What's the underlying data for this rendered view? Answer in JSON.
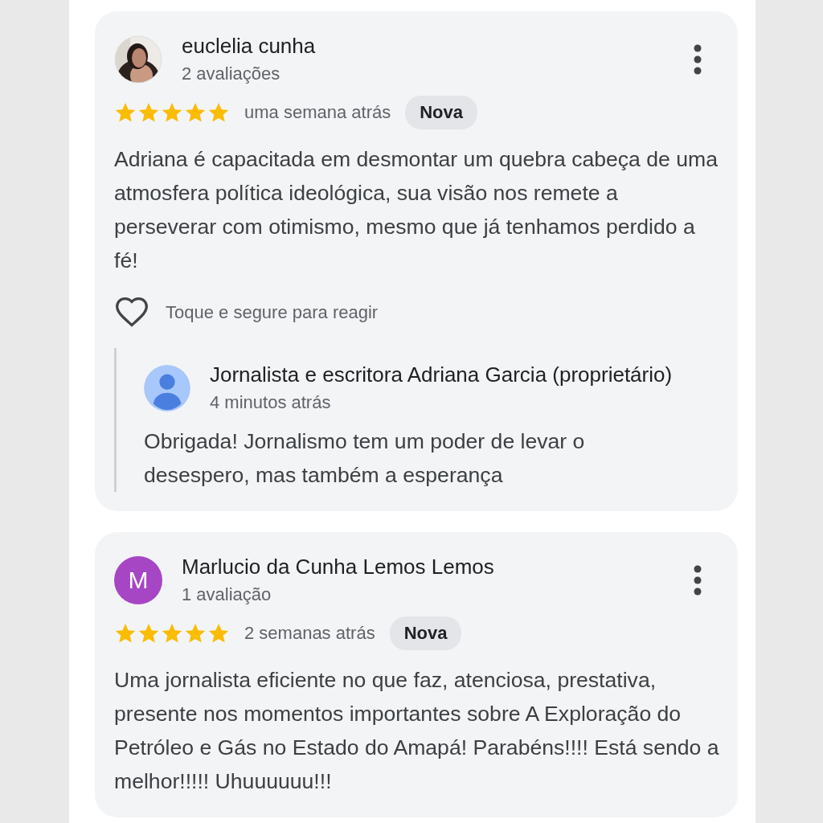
{
  "reviews": [
    {
      "name": "euclelia cunha",
      "count": "2 avaliações",
      "stars": 5,
      "time": "uma semana atrás",
      "badge": "Nova",
      "text": "Adriana é capacitada em desmontar um quebra cabeça de uma atmosfera política ideológica, sua visão nos remete a perseverar com otimismo, mesmo que já tenhamos perdido a fé!",
      "react": "Toque e segure para reagir",
      "reply": {
        "name": "Jornalista e escritora Adriana Garcia (proprietário)",
        "time": "4 minutos atrás",
        "text": "Obrigada! Jornalismo tem um poder de levar o desespero, mas também a esperança"
      }
    },
    {
      "avatar": {
        "kind": "letter",
        "letter": "M",
        "color": "#a646c4"
      },
      "name": "Marlucio da Cunha Lemos Lemos",
      "count": "1 avaliação",
      "stars": 5,
      "time": "2 semanas atrás",
      "badge": "Nova",
      "text": "Uma jornalista eficiente no que faz, atenciosa, prestativa, presente nos momentos importantes sobre A Exploração do Petróleo e Gás no Estado do Amapá! Parabéns!!!! Está sendo a melhor!!!!! Uhuuuuuu!!!"
    }
  ]
}
